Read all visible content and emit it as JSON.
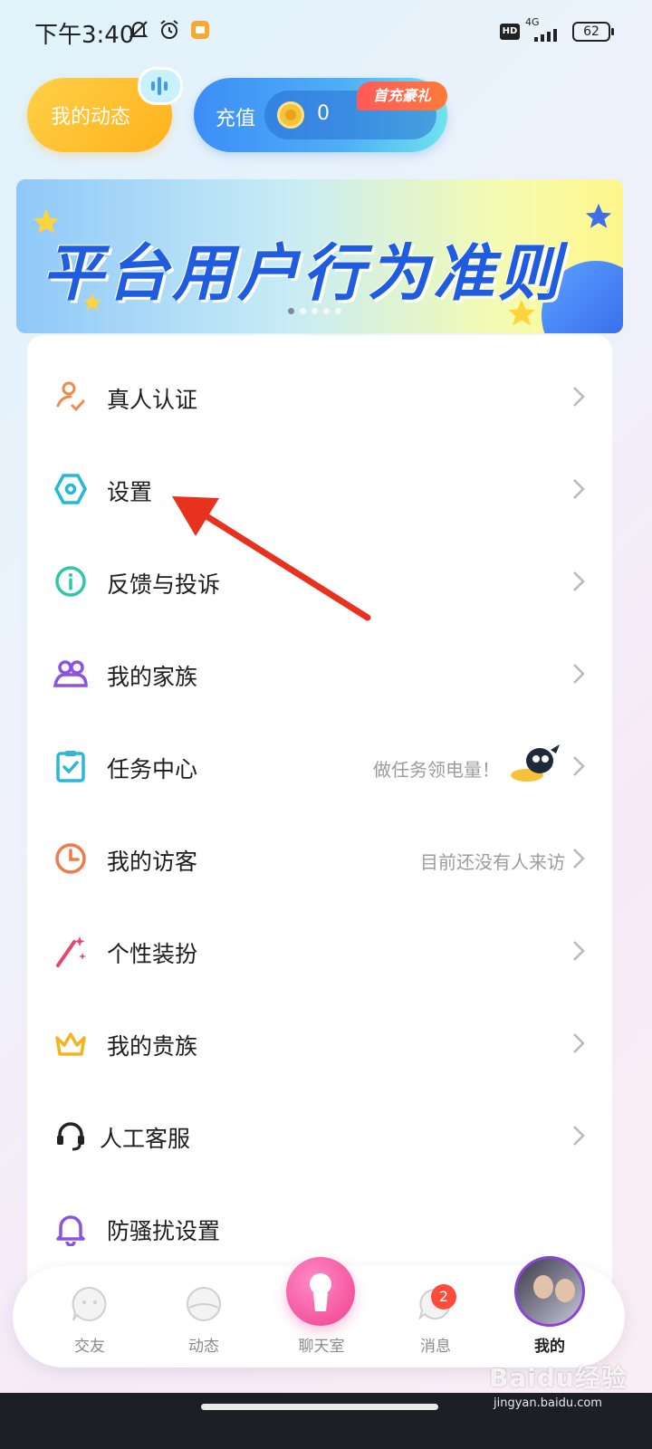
{
  "status_bar": {
    "time": "下午3:40",
    "hd": "HD",
    "network": "4G",
    "battery": "62"
  },
  "header": {
    "moments_label": "我的动态",
    "recharge_label": "充值",
    "coin_balance": "0",
    "first_recharge_badge": "首充豪礼"
  },
  "banner": {
    "title": "平台用户行为准则",
    "slide_count": 5,
    "active_slide": 1
  },
  "menu": {
    "items": [
      {
        "label": "真人认证",
        "hint": "",
        "icon": "verify-person-icon"
      },
      {
        "label": "设置",
        "hint": "",
        "icon": "settings-hexagon-icon"
      },
      {
        "label": "反馈与投诉",
        "hint": "",
        "icon": "info-icon"
      },
      {
        "label": "我的家族",
        "hint": "",
        "icon": "family-icon"
      },
      {
        "label": "任务中心",
        "hint": "做任务领电量！",
        "icon": "task-clipboard-icon"
      },
      {
        "label": "我的访客",
        "hint": "目前还没有人来访",
        "icon": "clock-icon"
      },
      {
        "label": "个性装扮",
        "hint": "",
        "icon": "magic-wand-icon"
      },
      {
        "label": "我的贵族",
        "hint": "",
        "icon": "crown-icon"
      },
      {
        "label": "人工客服",
        "hint": "",
        "icon": "headset-icon"
      },
      {
        "label": "防骚扰设置",
        "hint": "",
        "icon": "bell-icon"
      }
    ]
  },
  "tabs": [
    {
      "label": "交友",
      "icon": "friends-tab-icon"
    },
    {
      "label": "动态",
      "icon": "moments-tab-icon"
    },
    {
      "label": "聊天室",
      "icon": "microphone-icon"
    },
    {
      "label": "消息",
      "icon": "message-tab-icon"
    },
    {
      "label": "我的",
      "icon": "profile-avatar"
    }
  ],
  "message_badge": "2",
  "watermark": {
    "brand": "Baidu经验",
    "url": "jingyan.baidu.com"
  },
  "colors": {
    "accent_yellow": "#ffb21c",
    "accent_blue": "#3c8df6",
    "accent_pink": "#f4569e",
    "annotation_red": "#e8321e"
  }
}
